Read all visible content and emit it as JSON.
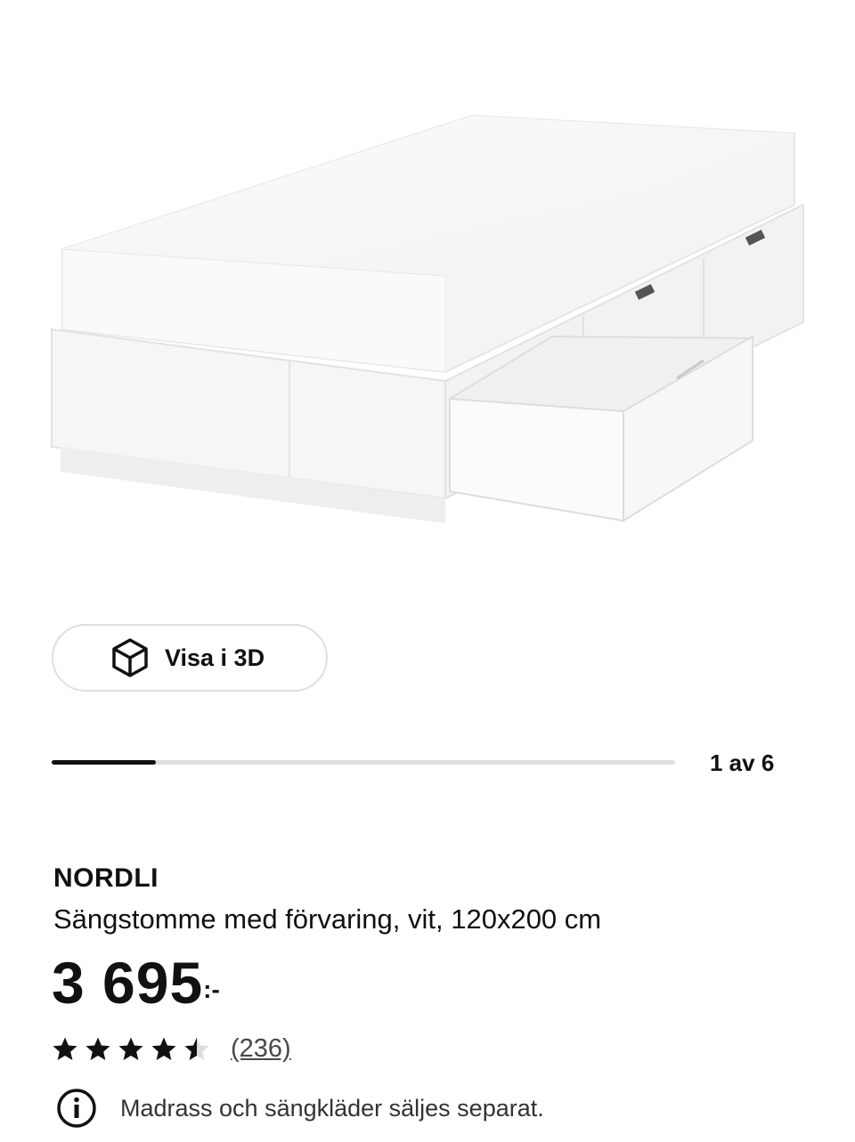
{
  "product_image": {
    "alt": "NORDLI sängstomme med förvaring, vit"
  },
  "view3d": {
    "label": "Visa i 3D",
    "icon": "cube-3d-icon"
  },
  "gallery": {
    "page_text": "1 av 6",
    "current": 1,
    "total": 6
  },
  "product": {
    "brand": "NORDLI",
    "description": "Sängstomme med förvaring, vit, 120x200 cm",
    "price_main": "3 695",
    "price_suffix": ":-"
  },
  "rating": {
    "stars": 4.5,
    "max": 5,
    "review_count": "(236)"
  },
  "notice": {
    "text": "Madrass och sängkläder säljes separat.",
    "icon": "info-icon"
  },
  "colors": {
    "text": "#111111",
    "border": "#dfdfdf",
    "progress": "#111111"
  }
}
